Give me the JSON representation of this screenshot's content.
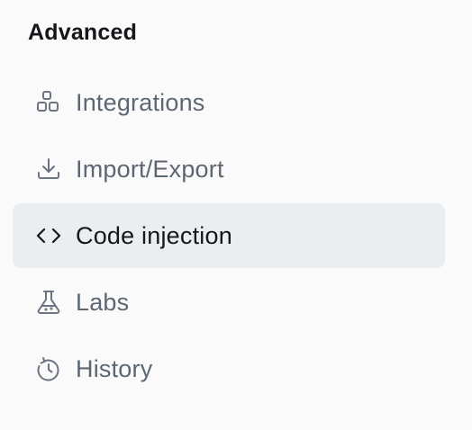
{
  "section": {
    "title": "Advanced"
  },
  "items": [
    {
      "label": "Integrations",
      "icon": "integrations-icon",
      "active": false
    },
    {
      "label": "Import/Export",
      "icon": "download-icon",
      "active": false
    },
    {
      "label": "Code injection",
      "icon": "code-icon",
      "active": true
    },
    {
      "label": "Labs",
      "icon": "flask-icon",
      "active": false
    },
    {
      "label": "History",
      "icon": "history-icon",
      "active": false
    }
  ],
  "colors": {
    "background": "#fafafa",
    "active_background": "#ebeef0",
    "text_active": "#15171a",
    "text_muted": "#5d6672",
    "icon_muted": "#6b7480"
  }
}
